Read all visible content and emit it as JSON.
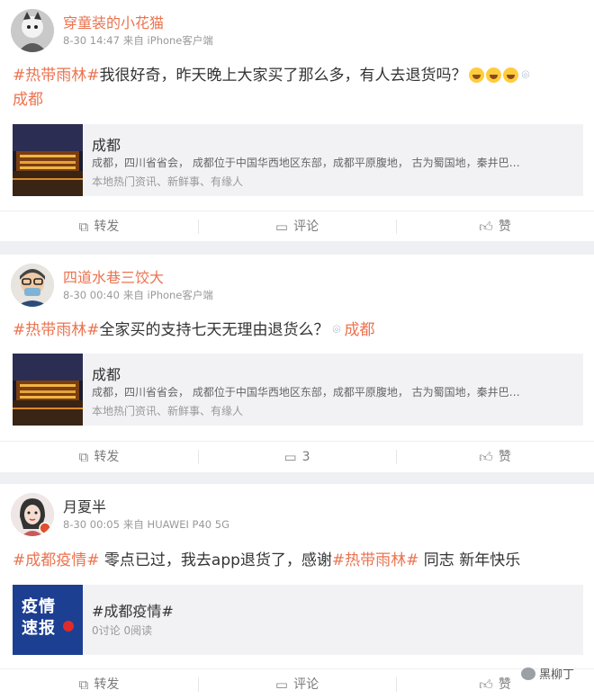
{
  "posts": [
    {
      "username": "穿童装的小花猫",
      "date": "8-30 14:47",
      "source": "来自 iPhone客户端",
      "tag": "#热带雨林#",
      "text": "我很好奇，昨天晚上大家买了那么多，有人去退货吗？",
      "location": "成都",
      "card": {
        "title": "成都",
        "desc": "成都，四川省省会，  成都位于中国华西地区东部，成都平原腹地，  古为蜀国地，秦井巴…",
        "sub": "本地热门资讯、新鲜事、有缘人"
      },
      "actions": {
        "repost": "转发",
        "comment": "评论",
        "like": "赞"
      }
    },
    {
      "username": "四道水巷三饺大",
      "date": "8-30 00:40",
      "source": "来自 iPhone客户端",
      "tag": "#热带雨林#",
      "text": "全家买的支持七天无理由退货么？",
      "location": "成都",
      "card": {
        "title": "成都",
        "desc": "成都，四川省省会，  成都位于中国华西地区东部，成都平原腹地，  古为蜀国地，秦井巴…",
        "sub": "本地热门资讯、新鲜事、有缘人"
      },
      "actions": {
        "repost": "转发",
        "comment": "3",
        "like": "赞"
      }
    },
    {
      "username": "月夏半",
      "date": "8-30 00:05",
      "source": "来自 HUAWEI P40 5G",
      "tag1": "#成都疫情#",
      "text1": " 零点已过，我去app退货了，感谢",
      "tag2": "#热带雨林#",
      "text2": " 同志 新年快乐",
      "card": {
        "img_line1": "疫情",
        "img_line2": "速报",
        "title": "#成都疫情#",
        "desc": "0讨论 0阅读"
      },
      "actions": {
        "repost": "转发",
        "comment": "评论",
        "like": "赞"
      }
    }
  ],
  "watermark": "黑柳丁",
  "colors": {
    "accent": "#eb7350",
    "card_bg": "#f2f2f5",
    "topic_blue": "#1c3f91"
  },
  "icons": [
    "location-pin-icon",
    "repost-icon",
    "comment-icon",
    "like-icon",
    "laugh-emoji-icon"
  ]
}
